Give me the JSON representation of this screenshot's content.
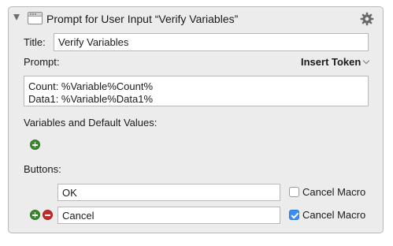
{
  "header": {
    "title": "Prompt for User Input “Verify Variables”",
    "icons": [
      "disclosure-triangle-icon",
      "window-icon",
      "gear-icon"
    ]
  },
  "fields": {
    "title_label": "Title:",
    "title_value": "Verify Variables",
    "prompt_label": "Prompt:",
    "insert_token": "Insert Token",
    "prompt_lines": [
      "Count: %Variable%Count%",
      "Data1: %Variable%Data1%"
    ],
    "variables_label": "Variables and Default Values:",
    "buttons_label": "Buttons:"
  },
  "buttons": [
    {
      "name": "OK",
      "cancel_macro_label": "Cancel Macro",
      "cancel_macro_checked": false
    },
    {
      "name": "Cancel",
      "cancel_macro_label": "Cancel Macro",
      "cancel_macro_checked": true
    }
  ],
  "colors": {
    "panel_bg": "#ececec",
    "add_green": "#3a8a2a",
    "remove_red": "#c42b2b",
    "checkbox_blue": "#3b8df5"
  }
}
